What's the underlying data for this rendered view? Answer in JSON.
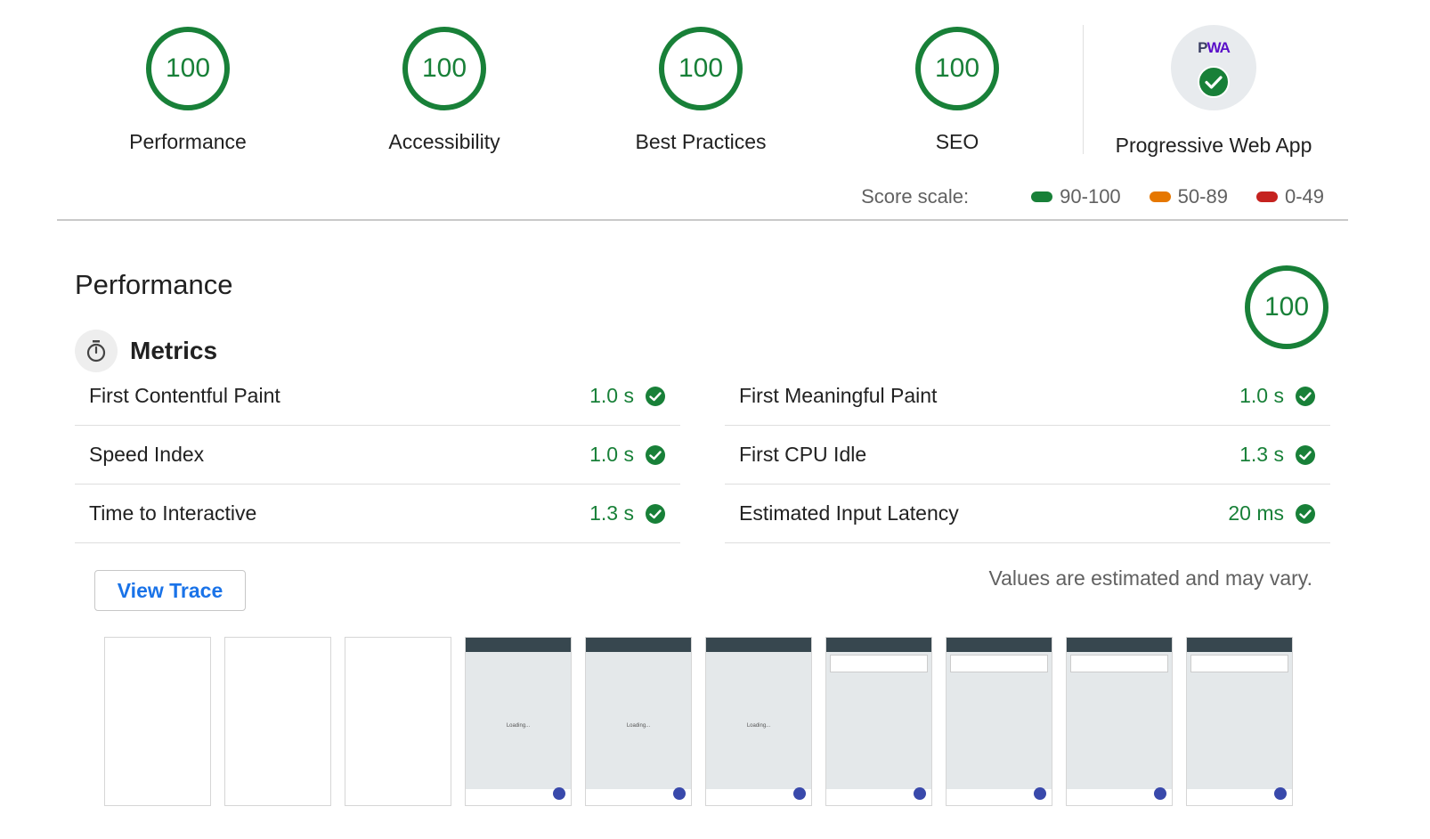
{
  "categories": [
    {
      "score": "100",
      "label": "Performance"
    },
    {
      "score": "100",
      "label": "Accessibility"
    },
    {
      "score": "100",
      "label": "Best Practices"
    },
    {
      "score": "100",
      "label": "SEO"
    }
  ],
  "pwa": {
    "badge_text_p": "P",
    "badge_text_wa": "WA",
    "label": "Progressive Web App",
    "icon": "check-circle-icon"
  },
  "scale": {
    "label": "Score scale:",
    "items": [
      {
        "range": "90-100",
        "color": "#188038"
      },
      {
        "range": "50-89",
        "color": "#e67700"
      },
      {
        "range": "0-49",
        "color": "#c5221f"
      }
    ]
  },
  "performance": {
    "title": "Performance",
    "score": "100",
    "metrics_title": "Metrics",
    "left_metrics": [
      {
        "name": "First Contentful Paint",
        "value": "1.0 s"
      },
      {
        "name": "Speed Index",
        "value": "1.0 s"
      },
      {
        "name": "Time to Interactive",
        "value": "1.3 s"
      }
    ],
    "right_metrics": [
      {
        "name": "First Meaningful Paint",
        "value": "1.0 s"
      },
      {
        "name": "First CPU Idle",
        "value": "1.3 s"
      },
      {
        "name": "Estimated Input Latency",
        "value": "20 ms"
      }
    ],
    "view_trace": "View Trace",
    "estimated_note": "Values are estimated and may vary.",
    "loading_text": "Loading..."
  },
  "colors": {
    "pass": "#188038",
    "link": "#1a73e8"
  }
}
